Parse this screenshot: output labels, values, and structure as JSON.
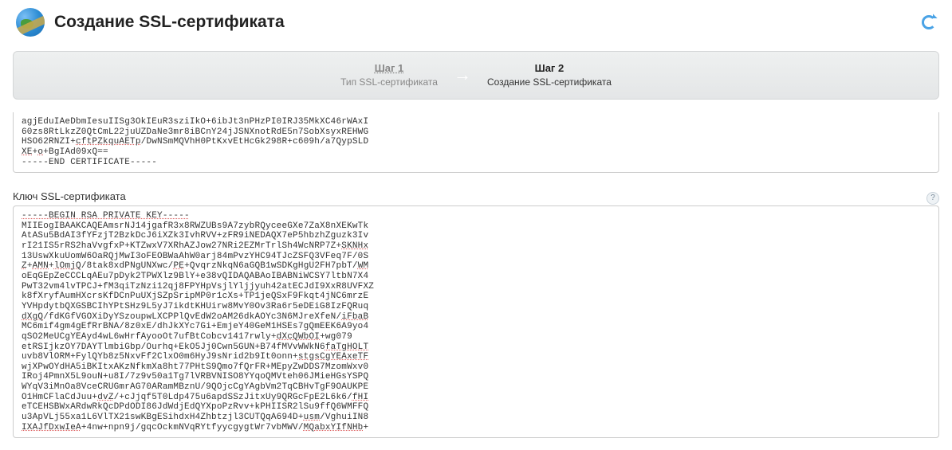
{
  "header": {
    "title": "Создание SSL-сертификата"
  },
  "stepper": {
    "step1": {
      "title": "Шаг 1",
      "sub": "Тип SSL-сертификата"
    },
    "step2": {
      "title": "Шаг 2",
      "sub": "Создание SSL-сертификата"
    }
  },
  "certBox": {
    "line1": "agjEduIAeDbmIesuIISg3OkIEuR3sziIkO+6ibJt3nPHzPI0IRJ35MkXC46rWAxI",
    "line2": "60zs8RtLkzZ0QtCmL22juUZDaNe3mr8iBCnY24jJSNXnotRdE5n7SobXsyxREHWG",
    "line3_pre": "HSO62RNZI+",
    "line3_u": "cftPZkquAETp",
    "line3_post": "/DwNSmMQVhH0PtKxvEtHcGk298R+c609h/a7QypSLD",
    "line4_u1": "XE",
    "line4_mid": "+",
    "line4_u2": "o",
    "line4_post": "+BgIAd09xQ==",
    "line5": "-----END CERTIFICATE-----"
  },
  "keySection": {
    "label": "Ключ SSL-сертификата",
    "line1": "-----BEGIN RSA PRIVATE KEY-----",
    "line2": "MIIEogIBAAKCAQEAmsrNJ14jgafR3x8RWZUBs9A7zybRQyceeGXe7ZaX8nXEKwTk",
    "line3": "AtASu5BdAI3fYFzjT2BzkDcJ6iXZk3IvhRVV+zFR9iNEDAQX7eP5hbzhZguzk3Iv",
    "line4_pre": "rI21IS5rRS2haVvgfxP+KTZwxV7XRhAZJow27NRi2EZMrTrlSh4WcNRP7Z+",
    "line4_u": "SKNHx",
    "line5": "13UswXkuUomW6OaRQjMwI3oFEOBWaAhW0arj84mPvzYHC94TJcZSFQ3VFeq7F/0S",
    "line6_u1": "Z",
    "line6_m1": "+",
    "line6_u2": "AMN",
    "line6_m2": "+",
    "line6_u3": "lOmjQ",
    "line6_m3": "/8tak8xdPNgUNXwc/",
    "line6_u4": "PE",
    "line6_m4": "+QvqrzNkqN6aGQB1wSDKgHgU2FH7pbT/",
    "line6_u5": "WM",
    "line7": "oEqGEpZeCCCLqAEu7pDyk2TPWXlz9BlY+e38vQIDAQABAoIBABNiWCSY7ltbN7X4",
    "line8": "PwT32vm4lvTPCJ+fM3qiTzNzi12qj8FPYHpVsjlYljjyuh42atECJdI9XxR8UVFXZ",
    "line9": "k8fXryfAumHXcrsKfDCnPuUXjSZpSripMP0r1cXs+TP1jeQSxF9Fkqt4jNC6mrzE",
    "line10": "YVHpdytbQXGSBCIhYPtSHz9L5yJ7ikdtKHUirw8MvY0Ov3Ra6r5eDEiG8IzFQRuq",
    "line11_u1": "dXgQ",
    "line11_m1": "/fdKGfVGOXiDyYSzoupwLXCPPlQvEdW2oAM26dkAOYc3N6MJreXfeN/",
    "line11_u2": "iFbaB",
    "line12": "MC6mif4gm4gEfRrBNA/8z0xE/dhJkXYc7Gi+EmjeY40GeM1HSEs7gQmEEK6A9yo4",
    "line13_pre": "qSO2MeUCgYEAyd4wL6wHrfAyooOt7ufBtCobcv1417rwly+",
    "line13_u": "dXcQWbOI",
    "line13_post": "+wg079",
    "line14_pre": "etRSIjkzOY7DAYTlmbiGbp/Ourhq+EkO5Jj0Cwn5GUN+B74fMVvWWkN6",
    "line14_u": "faTgHOLT",
    "line15_pre": "uvb8VlORM+FylQYb8z5NxvFf2ClxO0m6HyJ9sNrid2b9It0onn+",
    "line15_u": "stgsCgYEAxeTF",
    "line16": "wjXPwOYdHA5iBKItxAKzNfkmXa8ht77PHtS9Qmo7fQrFR+MEpyZwDDS7MzomWxv0",
    "line17": "IRoj4PmnX5L9ouN+u8I/7z9v50a1Tg7lVRBVNISO8YYqoQMVteh06JMieHGsYSPQ",
    "line18": "WYqV3iMnOa8VceCRUGmrAG70ARamMBznU/9QOjcCgYAgbVm2TqCBHvTgF9OAUKPE",
    "line19_pre": "O1HmCFlaCdJuu+",
    "line19_u1": "dvZ",
    "line19_m1": "/+cJjqf5T0Ldp475u6apdSSzJitxUy9QRGcFpE2L6k6/",
    "line19_u2": "fHI",
    "line20": "eTCEHSBWxARdwRkQcDPdODI86JdWdjEdQYXpoPzRvv+kPHIISR2lSu9ffQ6WMFFQ",
    "line21_pre": "u3ApVLj55xa1L6VlTX21swKBgESihdxH4Zhbtzjl3CUTQqA694D+",
    "line21_u": "usm",
    "line21_post": "/VghuiIN8",
    "line22_u1": "IXAJfDxwIeA",
    "line22_m1": "+4nw+npn9j/gqcOckmNVqRYtfyycgygtWr7vbMWV/",
    "line22_u2": "MQabxYIfNHb",
    "line22_post": "+"
  }
}
